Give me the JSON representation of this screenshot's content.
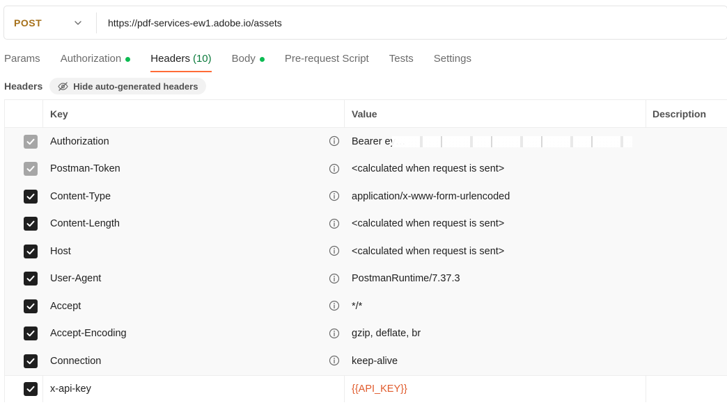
{
  "request": {
    "method": "POST",
    "url": "https://pdf-services-ew1.adobe.io/assets"
  },
  "tabs": [
    {
      "label": "Params"
    },
    {
      "label": "Authorization",
      "dot": true
    },
    {
      "label": "Headers",
      "count": "(10)",
      "active": true
    },
    {
      "label": "Body",
      "dot": true
    },
    {
      "label": "Pre-request Script"
    },
    {
      "label": "Tests"
    },
    {
      "label": "Settings"
    }
  ],
  "headers_section": {
    "title": "Headers",
    "hide_button": "Hide auto-generated headers"
  },
  "table": {
    "columns": {
      "key": "Key",
      "value": "Value",
      "description": "Description"
    },
    "rows": [
      {
        "key": "Authorization",
        "value": "Bearer ey…",
        "checked": "dim",
        "info": true,
        "redacted": true
      },
      {
        "key": "Postman-Token",
        "value": "<calculated when request is sent>",
        "checked": "dim",
        "info": true
      },
      {
        "key": "Content-Type",
        "value": "application/x-www-form-urlencoded",
        "checked": "on",
        "info": true
      },
      {
        "key": "Content-Length",
        "value": "<calculated when request is sent>",
        "checked": "on",
        "info": true
      },
      {
        "key": "Host",
        "value": "<calculated when request is sent>",
        "checked": "on",
        "info": true
      },
      {
        "key": "User-Agent",
        "value": "PostmanRuntime/7.37.3",
        "checked": "on",
        "info": true
      },
      {
        "key": "Accept",
        "value": "*/*",
        "checked": "on",
        "info": true
      },
      {
        "key": "Accept-Encoding",
        "value": "gzip, deflate, br",
        "checked": "on",
        "info": true
      },
      {
        "key": "Connection",
        "value": "keep-alive",
        "checked": "on",
        "info": true
      },
      {
        "key": "x-api-key",
        "value": "{{API_KEY}}",
        "checked": "on",
        "info": false,
        "variable": true
      }
    ]
  },
  "colors": {
    "method": "#a6711b",
    "accent": "#ff6c37",
    "dot": "#0cbb52",
    "variable": "#e05a2b"
  },
  "icons": [
    "chevron-down-icon",
    "eye-off-icon",
    "info-icon",
    "checkmark-icon"
  ]
}
